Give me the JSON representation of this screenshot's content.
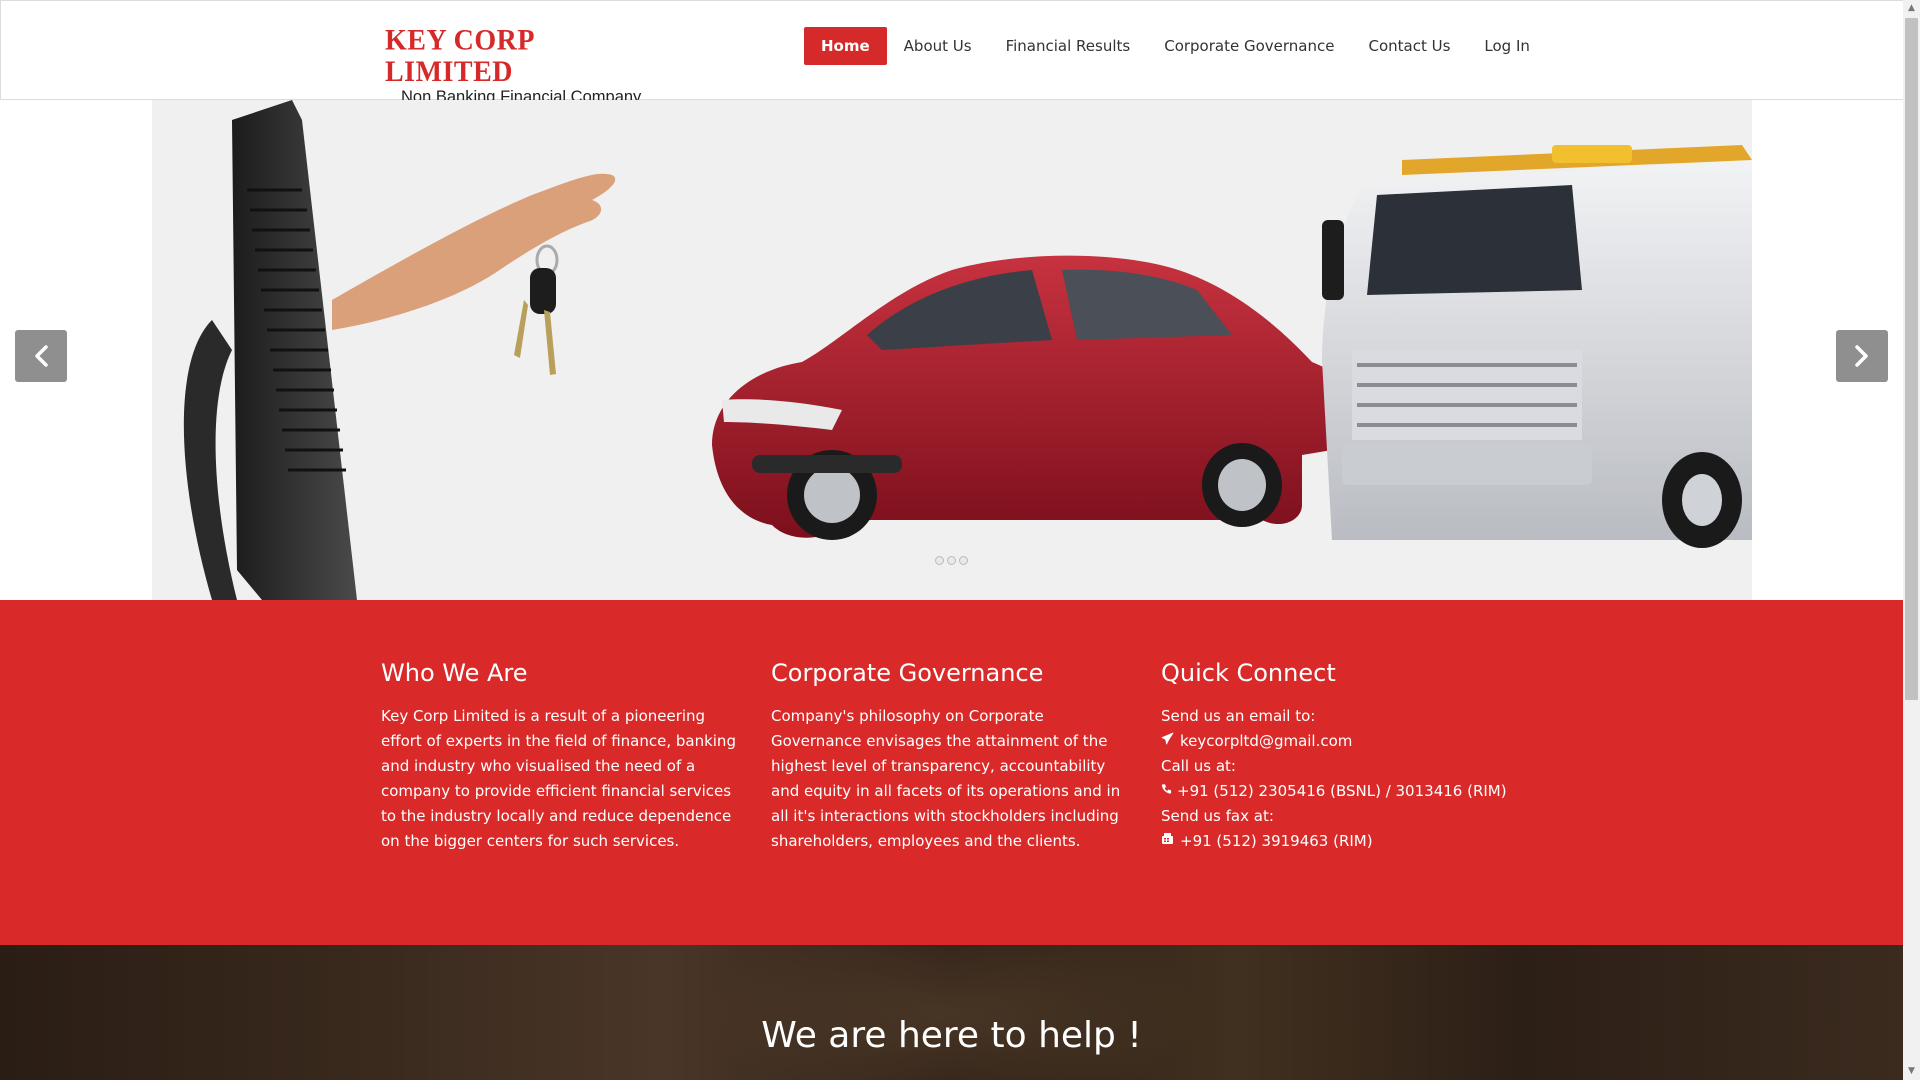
{
  "header": {
    "logo_title": "KEY CORP LIMITED",
    "logo_subtitle": "Non Banking Financial Company",
    "nav": [
      {
        "label": "Home",
        "active": true
      },
      {
        "label": "About Us"
      },
      {
        "label": "Financial Results"
      },
      {
        "label": "Corporate Governance"
      },
      {
        "label": "Contact Us"
      },
      {
        "label": "Log In"
      }
    ]
  },
  "slider": {
    "prev_icon": "chevron-left-icon",
    "next_icon": "chevron-right-icon",
    "dot_count": 3
  },
  "info": {
    "who": {
      "heading": "Who We Are",
      "text": "Key Corp Limited is a result of a pioneering effort of experts in the field of finance, banking and industry who visualised the need of a company to provide efficient financial services to the industry locally and reduce dependence on the bigger centers for such services."
    },
    "governance": {
      "heading": "Corporate Governance",
      "text": "Company's philosophy on Corporate Governance envisages the attainment of the highest level of transparency, accountability and equity in all facets of its operations and in all it's interactions with stockholders including shareholders, employees and the clients."
    },
    "connect": {
      "heading": "Quick Connect",
      "email_label": "Send us an email to:",
      "email": "keycorpltd@gmail.com",
      "call_label": "Call us at:",
      "phone": "+91 (512) 2305416 (BSNL) / 3013416 (RIM)",
      "fax_label": "Send us fax at:",
      "fax": "+91 (512) 3919463 (RIM)"
    }
  },
  "banner": {
    "title": "We are here to help !"
  },
  "colors": {
    "brand_red": "#d92a29",
    "nav_active": "#d62a2a"
  }
}
